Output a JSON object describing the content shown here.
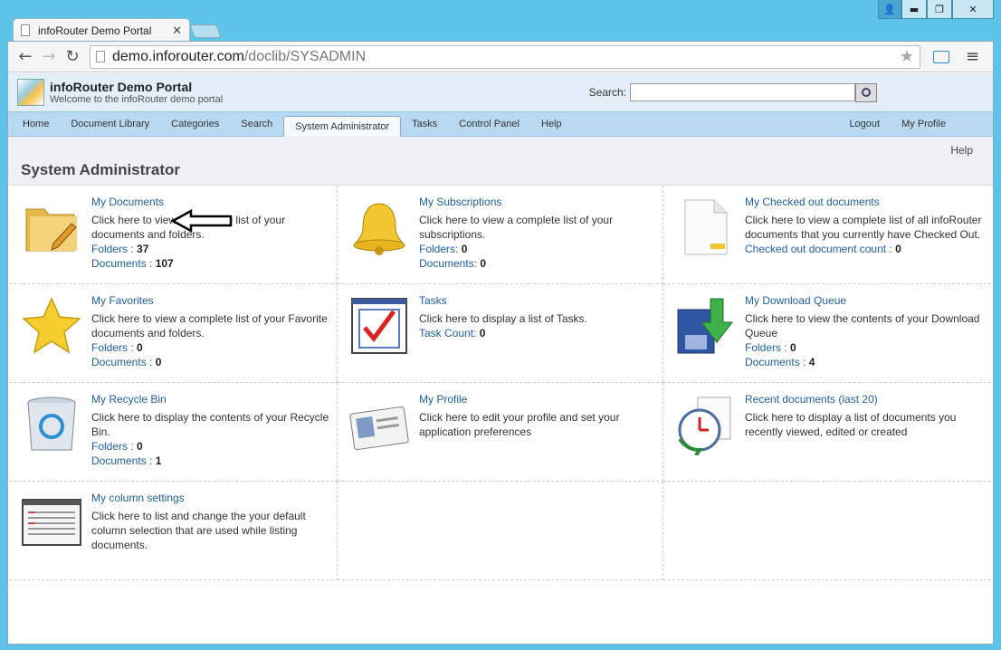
{
  "window": {
    "tab_title": "infoRouter Demo Portal",
    "tab_close": "✕",
    "controls": {
      "user": "👤",
      "minimize": "▬",
      "maximize": "❐",
      "close": "✕"
    }
  },
  "toolbar": {
    "back": "←",
    "forward": "→",
    "reload": "↻",
    "url_host": "demo.inforouter.com",
    "url_path": "/doclib/SYSADMIN",
    "star": "★",
    "menu": "≡"
  },
  "header": {
    "title": "infoRouter Demo Portal",
    "subtitle": "Welcome to the infoRouter demo portal",
    "search_label": "Search:"
  },
  "nav": {
    "items": [
      "Home",
      "Document Library",
      "Categories",
      "Search",
      "System Administrator",
      "Tasks",
      "Control Panel",
      "Help"
    ],
    "right": [
      "Logout",
      "My Profile"
    ]
  },
  "section": {
    "help": "Help",
    "title": "System Administrator"
  },
  "items": [
    {
      "title": "My Documents",
      "desc": "Click here to view a complete list of your documents and folders.",
      "stats": [
        [
          "Folders : ",
          "37"
        ],
        [
          "Documents : ",
          "107"
        ]
      ],
      "icon": "folder-icon"
    },
    {
      "title": "My Subscriptions",
      "desc": "Click here to view a complete list of your subscriptions.",
      "stats": [
        [
          "Folders: ",
          "0"
        ],
        [
          "Documents: ",
          "0"
        ]
      ],
      "icon": "bell-icon"
    },
    {
      "title": "My Checked out documents",
      "desc": "Click here to view a complete list of all infoRouter documents that you currently have Checked Out.",
      "stats": [
        [
          "Checked out document count : ",
          "0"
        ]
      ],
      "icon": "document-icon"
    },
    {
      "title": "My Favorites",
      "desc": "Click here to view a complete list of your Favorite documents and folders.",
      "stats": [
        [
          "Folders : ",
          "0"
        ],
        [
          "Documents : ",
          "0"
        ]
      ],
      "icon": "star-icon"
    },
    {
      "title": "Tasks",
      "desc": "Click here to display a list of Tasks.",
      "stats": [
        [
          "Task Count: ",
          "0"
        ]
      ],
      "icon": "checkbox-icon"
    },
    {
      "title": "My Download Queue",
      "desc": "Click here to view the contents of your Download Queue",
      "stats": [
        [
          "Folders : ",
          "0"
        ],
        [
          "Documents : ",
          "4"
        ]
      ],
      "icon": "download-icon"
    },
    {
      "title": "My Recycle Bin",
      "desc": "Click here to display the contents of your Recycle Bin.",
      "stats": [
        [
          "Folders : ",
          "0"
        ],
        [
          "Documents : ",
          "1"
        ]
      ],
      "icon": "recycle-bin-icon"
    },
    {
      "title": "My Profile",
      "desc": "Click here to edit your profile and set your application preferences",
      "stats": [],
      "icon": "id-card-icon"
    },
    {
      "title": "Recent documents (last 20)",
      "desc": "Click here to display a list of documents you recently viewed, edited or created",
      "stats": [],
      "icon": "clock-icon"
    },
    {
      "title": "My column settings",
      "desc": "Click here to list and change the your default column selection that are used while listing documents.",
      "stats": [],
      "icon": "columns-window-icon"
    }
  ]
}
